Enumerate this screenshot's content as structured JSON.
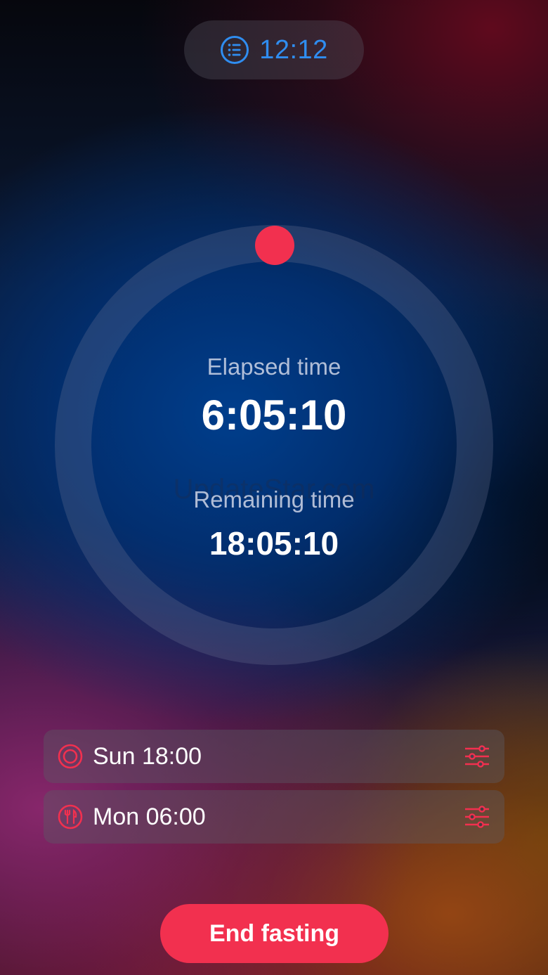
{
  "header": {
    "time": "12:12",
    "icon": "list-icon",
    "accent_color": "#2f8df0"
  },
  "timer": {
    "elapsed_label": "Elapsed time",
    "elapsed_value": "6:05:10",
    "remaining_label": "Remaining time",
    "remaining_value": "18:05:10",
    "knob_color": "#f2304f"
  },
  "watermark": "UpdateStar.com",
  "schedule": [
    {
      "icon": "target-icon",
      "label": "Sun 18:00",
      "settings_icon": "sliders-icon"
    },
    {
      "icon": "fork-knife-icon",
      "label": "Mon 06:00",
      "settings_icon": "sliders-icon"
    }
  ],
  "actions": {
    "end_label": "End fasting",
    "end_color": "#f2304f"
  }
}
